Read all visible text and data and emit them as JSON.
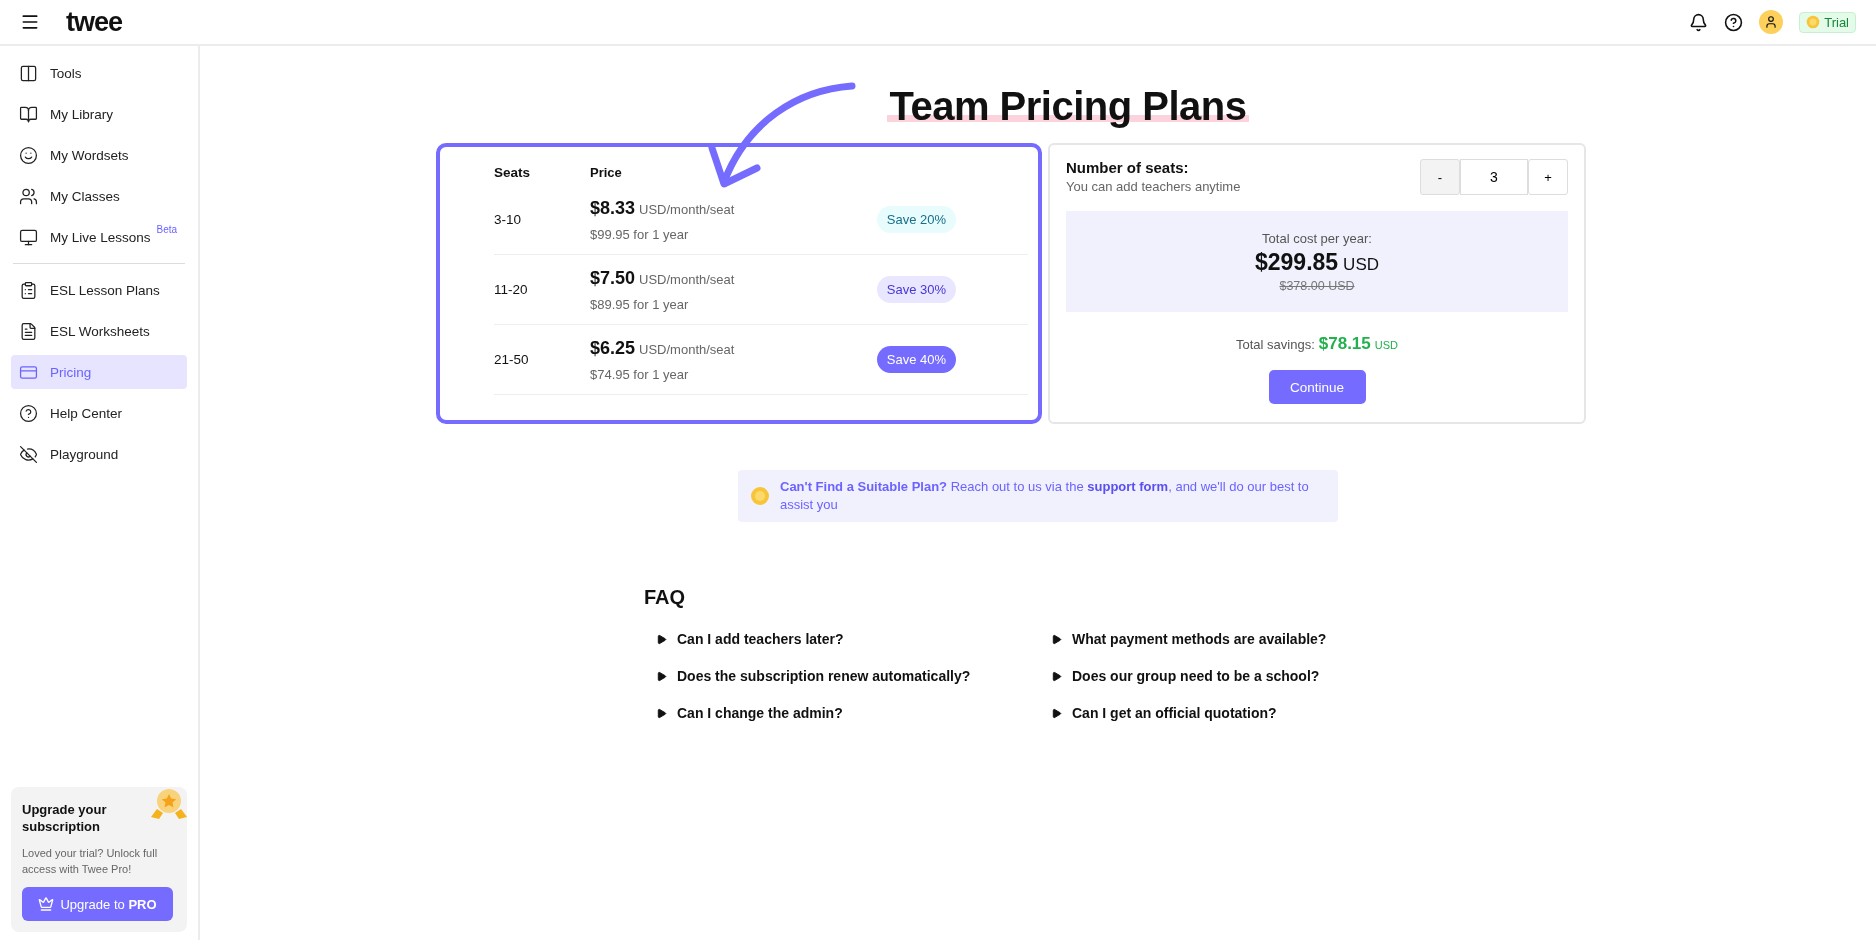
{
  "header": {
    "logo": "twee",
    "trial": "Trial"
  },
  "sidebar": {
    "items": [
      {
        "label": "Tools",
        "selected": false
      },
      {
        "label": "My Library",
        "selected": false
      },
      {
        "label": "My Wordsets",
        "selected": false
      },
      {
        "label": "My Classes",
        "selected": false
      },
      {
        "label": "My Live Lessons",
        "badge": "Beta",
        "selected": false
      },
      {
        "label": "ESL Lesson Plans",
        "selected": false,
        "divider_before": true
      },
      {
        "label": "ESL Worksheets",
        "selected": false
      },
      {
        "label": "Pricing",
        "selected": true
      },
      {
        "label": "Help Center",
        "selected": false
      },
      {
        "label": "Playground",
        "selected": false
      }
    ],
    "upgrade": {
      "title": "Upgrade your subscription",
      "text": "Loved your trial? Unlock full access with Twee Pro!",
      "button": "Upgrade to **PRO**"
    }
  },
  "title": "Team Pricing Plans",
  "plans": {
    "columns": [
      "Seats",
      "Price"
    ],
    "rows": [
      {
        "seats": "3-10",
        "price": "$8.33",
        "unit": "USD/month/seat",
        "yearly": "$99.95 for 1 year",
        "save": "Save 20%",
        "kind": "teal"
      },
      {
        "seats": "11-20",
        "price": "$7.50",
        "unit": "USD/month/seat",
        "yearly": "$89.95 for 1 year",
        "save": "Save 30%",
        "kind": "lavender"
      },
      {
        "seats": "21-50",
        "price": "$6.25",
        "unit": "USD/month/seat",
        "yearly": "$74.95 for 1 year",
        "save": "Save 40%",
        "kind": "solid"
      }
    ]
  },
  "calculator": {
    "label": "Number of seats:",
    "hint": "You can add teachers anytime",
    "minus": "-",
    "value": "3",
    "plus": "+",
    "cost_label": "Total cost per year:",
    "cost": "$299.85",
    "cost_unit": "USD",
    "old_cost": "$378.00 USD",
    "savings_label": "Total savings:",
    "savings": "$78.15",
    "savings_unit": "USD",
    "button": "Continue"
  },
  "banner": {
    "lead": "Can't Find a Suitable Plan?",
    "text_before": "Reach out to us via the",
    "link": "support form",
    "text_after": ", and we'll do our best to assist you"
  },
  "faq": {
    "title": "FAQ",
    "items": [
      "Can I add teachers later?",
      "What payment methods are available?",
      "Does the subscription renew automatically?",
      "Does our group need to be a school?",
      "Can I change the admin?",
      "Can I get an official quotation?"
    ]
  }
}
